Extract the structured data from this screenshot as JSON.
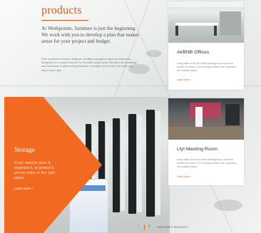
{
  "page": {
    "title": "products",
    "intro": "At Workpointe, furniture is just the beginning. We work with you to develop a plan that makes sense for your project and budget.",
    "body": "From architects to interior designers, facilities managers or general contractors, Workpointe is a trusted resource for the entire project team. We have the knowledge and experience to deliver design-forward, on-budget and on-time, and make sure they're done right."
  },
  "storage": {
    "heading": "Storage",
    "text": "If you need to store it, organize it, or protect it, you've come to the right place.",
    "link": "Learn More ›"
  },
  "cards": [
    {
      "title": "AirBNB Offices",
      "desc": "Using state-of-the-art mobile carriages you can store double the books in our storage solution with absolutely zero wasted space.",
      "link": "Learn More ›"
    },
    {
      "title": "Lfyt Meeting Room",
      "desc": "Using state-of-the-art mobile carriages you can store double the books in our storage solution with absolutely zero wasted space.",
      "link": "Learn More ›"
    }
  ],
  "nav": {
    "prev_icon": "‹",
    "next_icon": "›",
    "label": "VIEW NEXT PRODUCT"
  },
  "colors": {
    "accent": "#f26a21",
    "title": "#d65a22"
  }
}
